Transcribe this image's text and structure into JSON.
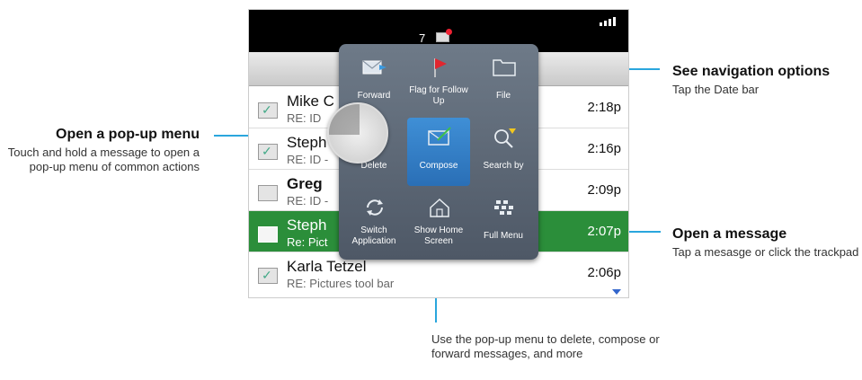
{
  "callouts": {
    "popup": {
      "title": "Open a pop-up menu",
      "text": "Touch and hold a message to open a pop-up menu of common actions"
    },
    "navigation": {
      "title": "See navigation options",
      "text": "Tap the Date bar"
    },
    "open_message": {
      "title": "Open a message",
      "text": "Tap a mesasge or click the trackpad"
    },
    "bottom": "Use the pop-up menu to delete, compose or forward messages, and more"
  },
  "status": {
    "unread_count": "7"
  },
  "messages": [
    {
      "sender": "Mike C",
      "subject": "RE: ID",
      "time": "2:18p",
      "bold": false,
      "selected": false
    },
    {
      "sender": "Steph",
      "subject": "RE: ID -",
      "time": "2:16p",
      "bold": false,
      "selected": false
    },
    {
      "sender": "Greg",
      "subject": "RE: ID -",
      "time": "2:09p",
      "bold": true,
      "selected": false
    },
    {
      "sender": "Steph",
      "subject": "Re: Pict",
      "time": "2:07p",
      "bold": false,
      "selected": true
    },
    {
      "sender": "Karla Tetzel",
      "subject": "RE: Pictures tool bar",
      "time": "2:06p",
      "bold": false,
      "selected": false
    }
  ],
  "menu": {
    "forward": "Forward",
    "flag": "Flag for Follow Up",
    "file": "File",
    "delete": "Delete",
    "compose": "Compose",
    "search_by": "Search by",
    "switch_app": "Switch Application",
    "show_home": "Show Home Screen",
    "full_menu": "Full Menu"
  },
  "colors": {
    "accent_line": "#2aa6dd",
    "selected_row": "#2b8e3a",
    "popup_bg": "#5e6a78",
    "active_item": "#3f8fd6",
    "flag": "#e0262f"
  }
}
